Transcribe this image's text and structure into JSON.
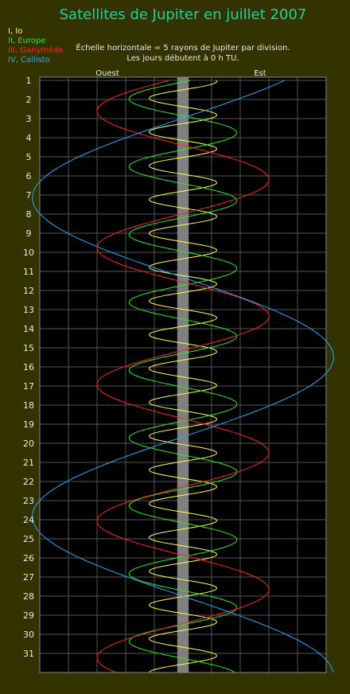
{
  "chart_data": {
    "type": "line",
    "title": "Satellites de Jupiter en juillet 2007",
    "notes": [
      "Échelle horizontale = 5 rayons de Jupiter par division.",
      "Les jours débutent à 0 h TU."
    ],
    "direction_labels": {
      "left": "Ouest",
      "right": "Est"
    },
    "x_unit_per_division": 5,
    "xlim": [
      -25,
      25
    ],
    "ylim": [
      1,
      32
    ],
    "y_ticks": [
      "1",
      "2",
      "3",
      "4",
      "5",
      "6",
      "7",
      "8",
      "9",
      "10",
      "11",
      "12",
      "13",
      "14",
      "15",
      "16",
      "17",
      "18",
      "19",
      "20",
      "21",
      "22",
      "23",
      "24",
      "25",
      "26",
      "27",
      "28",
      "29",
      "30",
      "31"
    ],
    "grid": true,
    "legend_position": "top-left",
    "series": [
      {
        "name": "I, Io",
        "color": "#ffff44",
        "amplitude": 5.9,
        "period_days": 1.769,
        "phase": 1.4
      },
      {
        "name": "II, Europe",
        "color": "#22ee22",
        "amplitude": 9.4,
        "period_days": 3.551,
        "phase": 3.0
      },
      {
        "name": "III, Ganymède",
        "color": "#ff2222",
        "amplitude": 15.0,
        "period_days": 7.155,
        "phase": 3.3
      },
      {
        "name": "IV, Callisto",
        "color": "#22aaff",
        "amplitude": 26.3,
        "period_days": 16.689,
        "phase": 2.4
      }
    ]
  }
}
